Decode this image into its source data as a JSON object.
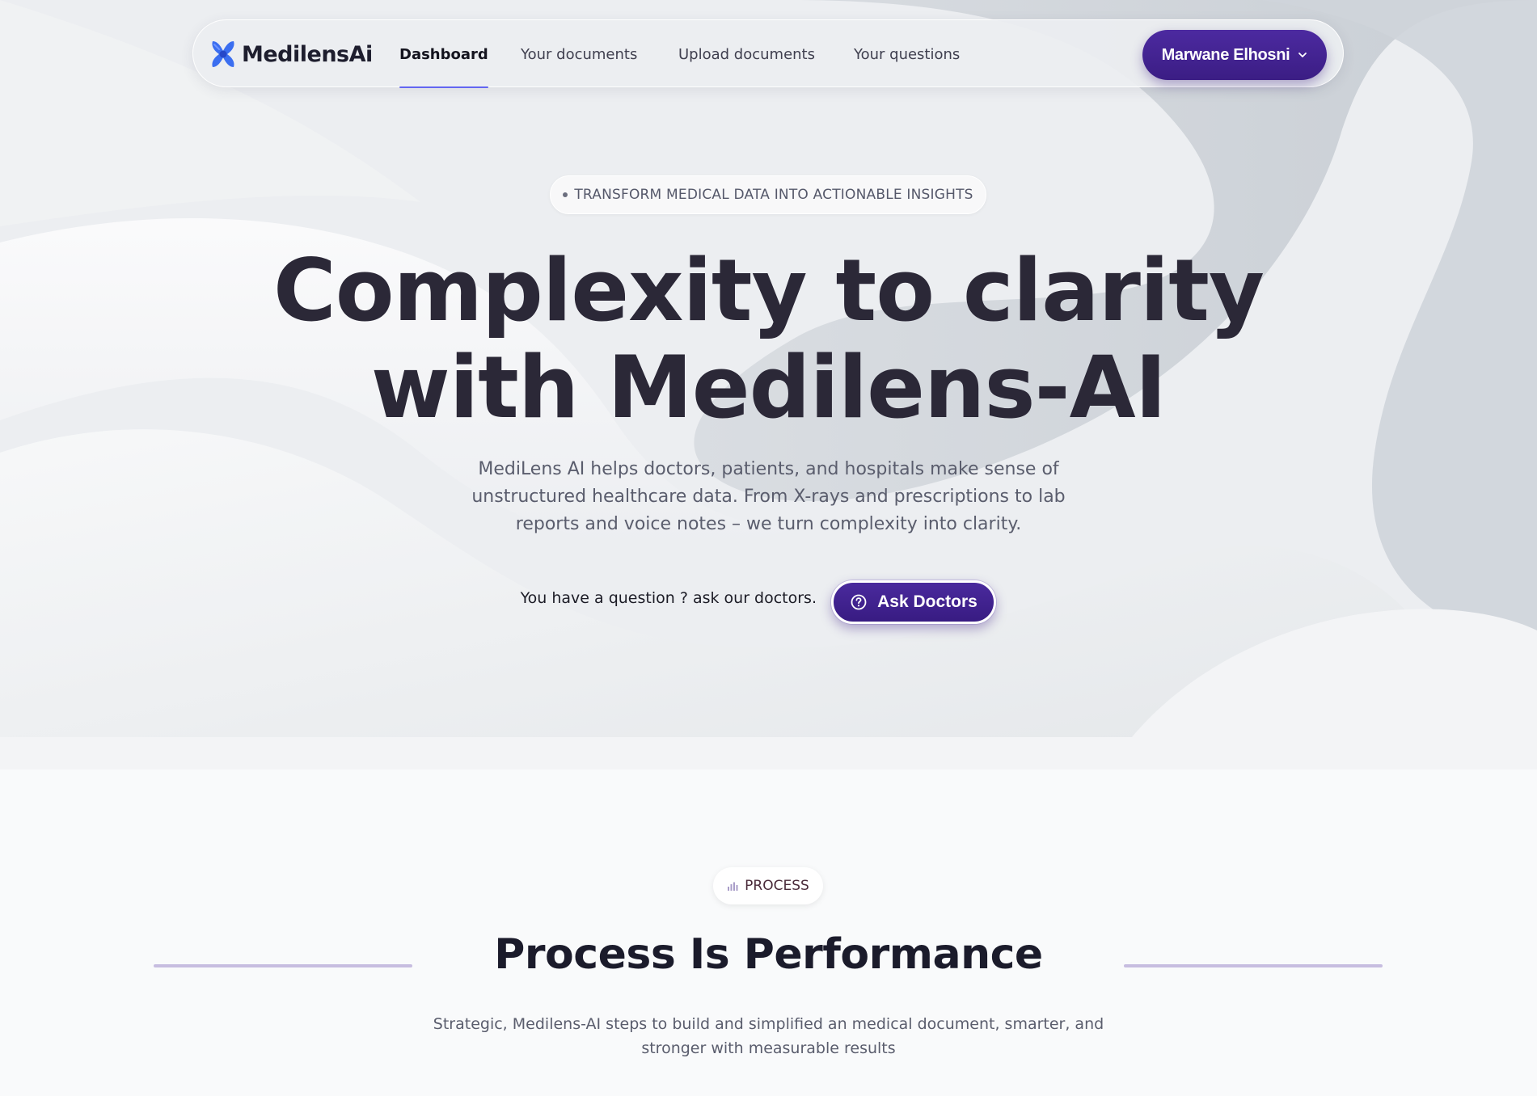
{
  "brand": {
    "name": "MedilensAi",
    "logo_icon": "medilens-x-logo",
    "accent_color": "#3b1d84",
    "logo_color": "#3b6ef0"
  },
  "nav": {
    "items": [
      {
        "label": "Dashboard",
        "active": true
      },
      {
        "label": "Your documents",
        "active": false
      },
      {
        "label": "Upload documents",
        "active": false
      },
      {
        "label": "Your questions",
        "active": false
      }
    ],
    "user": {
      "name": "Marwane Elhosni",
      "icon": "chevron-down-icon"
    }
  },
  "hero": {
    "tagline": "TRANSFORM MEDICAL DATA INTO ACTIONABLE INSIGHTS",
    "title_line1": "Complexity to clarity",
    "title_line2": "with Medilens-AI",
    "description": "MediLens AI helps doctors, patients, and hospitals make sense of unstructured healthcare data. From X-rays and prescriptions to lab reports and voice notes – we turn complexity into clarity.",
    "question_prompt": "You have a question ? ask our doctors.",
    "ask_button": "Ask Doctors",
    "ask_icon": "question-circle-icon"
  },
  "process": {
    "badge": "PROCESS",
    "badge_icon": "bar-chart-icon",
    "title": "Process Is Performance",
    "description": "Strategic, Medilens-AI steps to build and simplified an medical document, smarter, and stronger with measurable results"
  }
}
